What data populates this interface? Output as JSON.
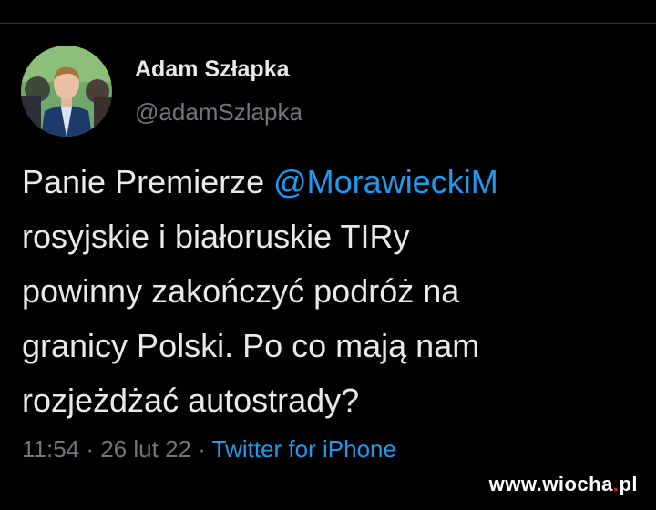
{
  "tweet": {
    "author": {
      "display_name": "Adam Szłapka",
      "handle": "@adamSzlapka",
      "avatar": "profile-photo"
    },
    "text": {
      "line1_prefix": "Panie Premierze ",
      "mention": "@MorawieckiM",
      "line2": "rosyjskie i białoruskie TIRy",
      "line3": "powinny zakończyć podróż na",
      "line4": "granicy Polski. Po co mają nam",
      "line5": "rozjeżdżać autostrady?"
    },
    "meta": {
      "time": "11:54",
      "separator": " · ",
      "date": "26 lut 22",
      "source": "Twitter for iPhone"
    }
  },
  "watermark": {
    "prefix": "www.wiocha",
    "dot": ".",
    "suffix": "pl"
  },
  "colors": {
    "background": "#000000",
    "text_primary": "#e7e9ea",
    "text_secondary": "#71767b",
    "link": "#1d9bf0",
    "watermark_accent": "#e2231a"
  }
}
